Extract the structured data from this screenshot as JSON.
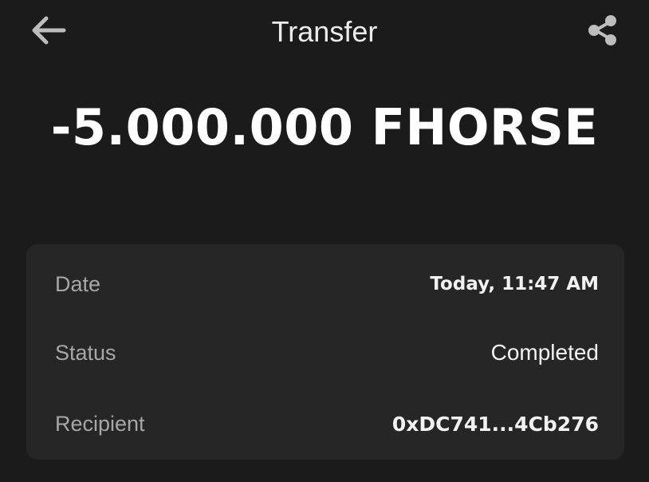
{
  "header": {
    "title": "Transfer",
    "back_icon": "arrow-left-icon",
    "share_icon": "share-icon"
  },
  "transaction": {
    "amount": "-5.000.000 FHORSE"
  },
  "details": {
    "date_label": "Date",
    "date_value": "Today, 11:47 AM",
    "status_label": "Status",
    "status_value": "Completed",
    "recipient_label": "Recipient",
    "recipient_value": "0xDC741...4Cb276"
  },
  "colors": {
    "background": "#1b1b1b",
    "card": "#262626",
    "label": "#a7a7a7",
    "text": "#ffffff"
  }
}
